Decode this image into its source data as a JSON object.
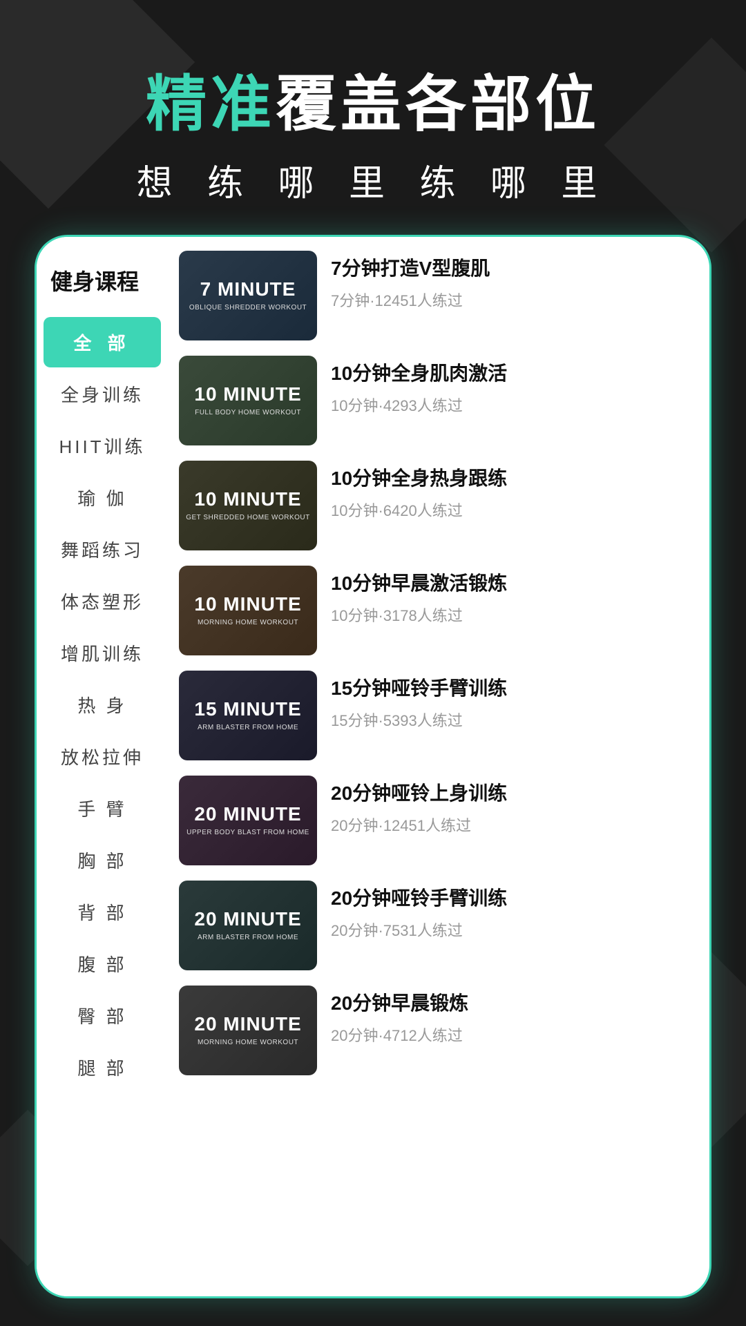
{
  "header": {
    "line1_accent": "精准",
    "line1_normal": "覆盖各部位",
    "line2": "想 练 哪 里 练 哪 里"
  },
  "sidebar": {
    "title": "健身课程",
    "items": [
      {
        "label": "全  部",
        "active": true
      },
      {
        "label": "全身训练",
        "active": false
      },
      {
        "label": "HIIT训练",
        "active": false
      },
      {
        "label": "瑜  伽",
        "active": false
      },
      {
        "label": "舞蹈练习",
        "active": false
      },
      {
        "label": "体态塑形",
        "active": false
      },
      {
        "label": "增肌训练",
        "active": false
      },
      {
        "label": "热  身",
        "active": false
      },
      {
        "label": "放松拉伸",
        "active": false
      },
      {
        "label": "手  臂",
        "active": false
      },
      {
        "label": "胸  部",
        "active": false
      },
      {
        "label": "背  部",
        "active": false
      },
      {
        "label": "腹  部",
        "active": false
      },
      {
        "label": "臀  部",
        "active": false
      },
      {
        "label": "腿  部",
        "active": false
      }
    ]
  },
  "workouts": [
    {
      "thumbnail_label": "7 MINUTE",
      "thumbnail_sub": "OBLIQUE SHREDDER WORKOUT",
      "thumb_class": "thumb-1",
      "title": "7分钟打造V型腹肌",
      "meta": "7分钟·12451人练过"
    },
    {
      "thumbnail_label": "10 MINUTE",
      "thumbnail_sub": "FULL BODY HOME WORKOUT",
      "thumb_class": "thumb-2",
      "title": "10分钟全身肌肉激活",
      "meta": "10分钟·4293人练过"
    },
    {
      "thumbnail_label": "10 MINUTE",
      "thumbnail_sub": "GET SHREDDED HOME WORKOUT",
      "thumb_class": "thumb-3",
      "title": "10分钟全身热身跟练",
      "meta": "10分钟·6420人练过"
    },
    {
      "thumbnail_label": "10 MINUTE",
      "thumbnail_sub": "MORNING HOME WORKOUT",
      "thumb_class": "thumb-4",
      "title": "10分钟早晨激活锻炼",
      "meta": "10分钟·3178人练过"
    },
    {
      "thumbnail_label": "15 MINUTE",
      "thumbnail_sub": "ARM BLASTER FROM HOME",
      "thumb_class": "thumb-5",
      "title": "15分钟哑铃手臂训练",
      "meta": "15分钟·5393人练过"
    },
    {
      "thumbnail_label": "20 MINUTE",
      "thumbnail_sub": "UPPER BODY BLAST FROM HOME",
      "thumb_class": "thumb-6",
      "title": "20分钟哑铃上身训练",
      "meta": "20分钟·12451人练过"
    },
    {
      "thumbnail_label": "20 MINUTE",
      "thumbnail_sub": "ARM BLASTER FROM HOME",
      "thumb_class": "thumb-7",
      "title": "20分钟哑铃手臂训练",
      "meta": "20分钟·7531人练过"
    },
    {
      "thumbnail_label": "20 MINUTE",
      "thumbnail_sub": "MORNING HOME WORKOUT",
      "thumb_class": "thumb-8",
      "title": "20分钟早晨锻炼",
      "meta": "20分钟·4712人练过"
    }
  ]
}
